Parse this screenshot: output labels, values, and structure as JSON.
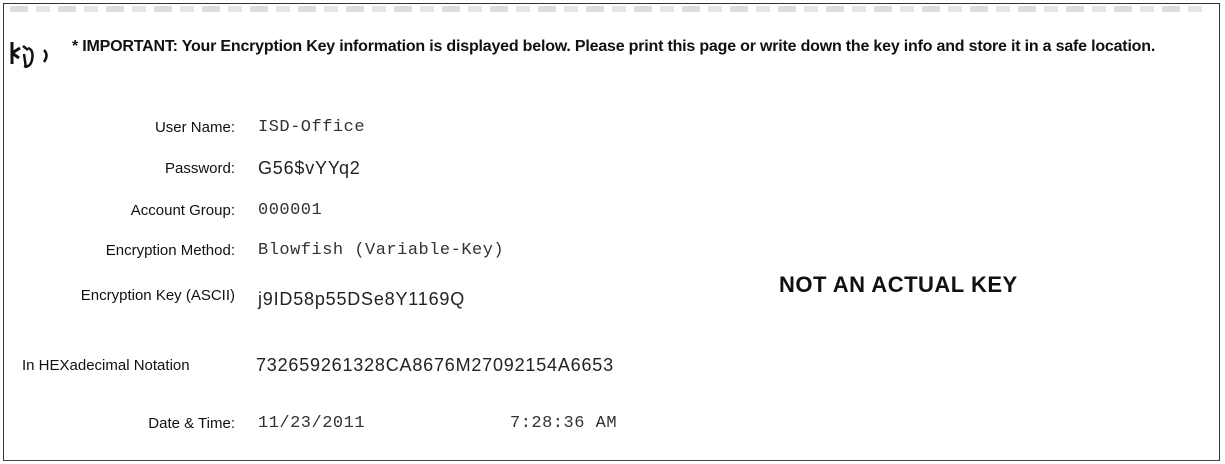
{
  "notice": {
    "text": "* IMPORTANT: Your Encryption Key information is displayed below.  Please print this page or write down the key info and store it in a safe location."
  },
  "fields": {
    "user_name_label": "User Name:",
    "user_name_value": "ISD-Office",
    "password_label": "Password:",
    "password_value": "G56$vYYq2",
    "account_group_label": "Account Group:",
    "account_group_value": "000001",
    "encryption_method_label": "Encryption Method:",
    "encryption_method_value": "Blowfish (Variable-Key)",
    "encryption_key_label": "Encryption Key (ASCII)",
    "encryption_key_value": "j9ID58p55DSe8Y1169Q",
    "hex_label": "In HEXadecimal Notation",
    "hex_value": "732659261328CA8676M27092154A6653",
    "date_time_label": "Date & Time:",
    "date_value": "11/23/2011",
    "time_value": "7:28:36 AM"
  },
  "stamp": "NOT AN ACTUAL KEY",
  "icons": {
    "notice": "key-icon"
  }
}
